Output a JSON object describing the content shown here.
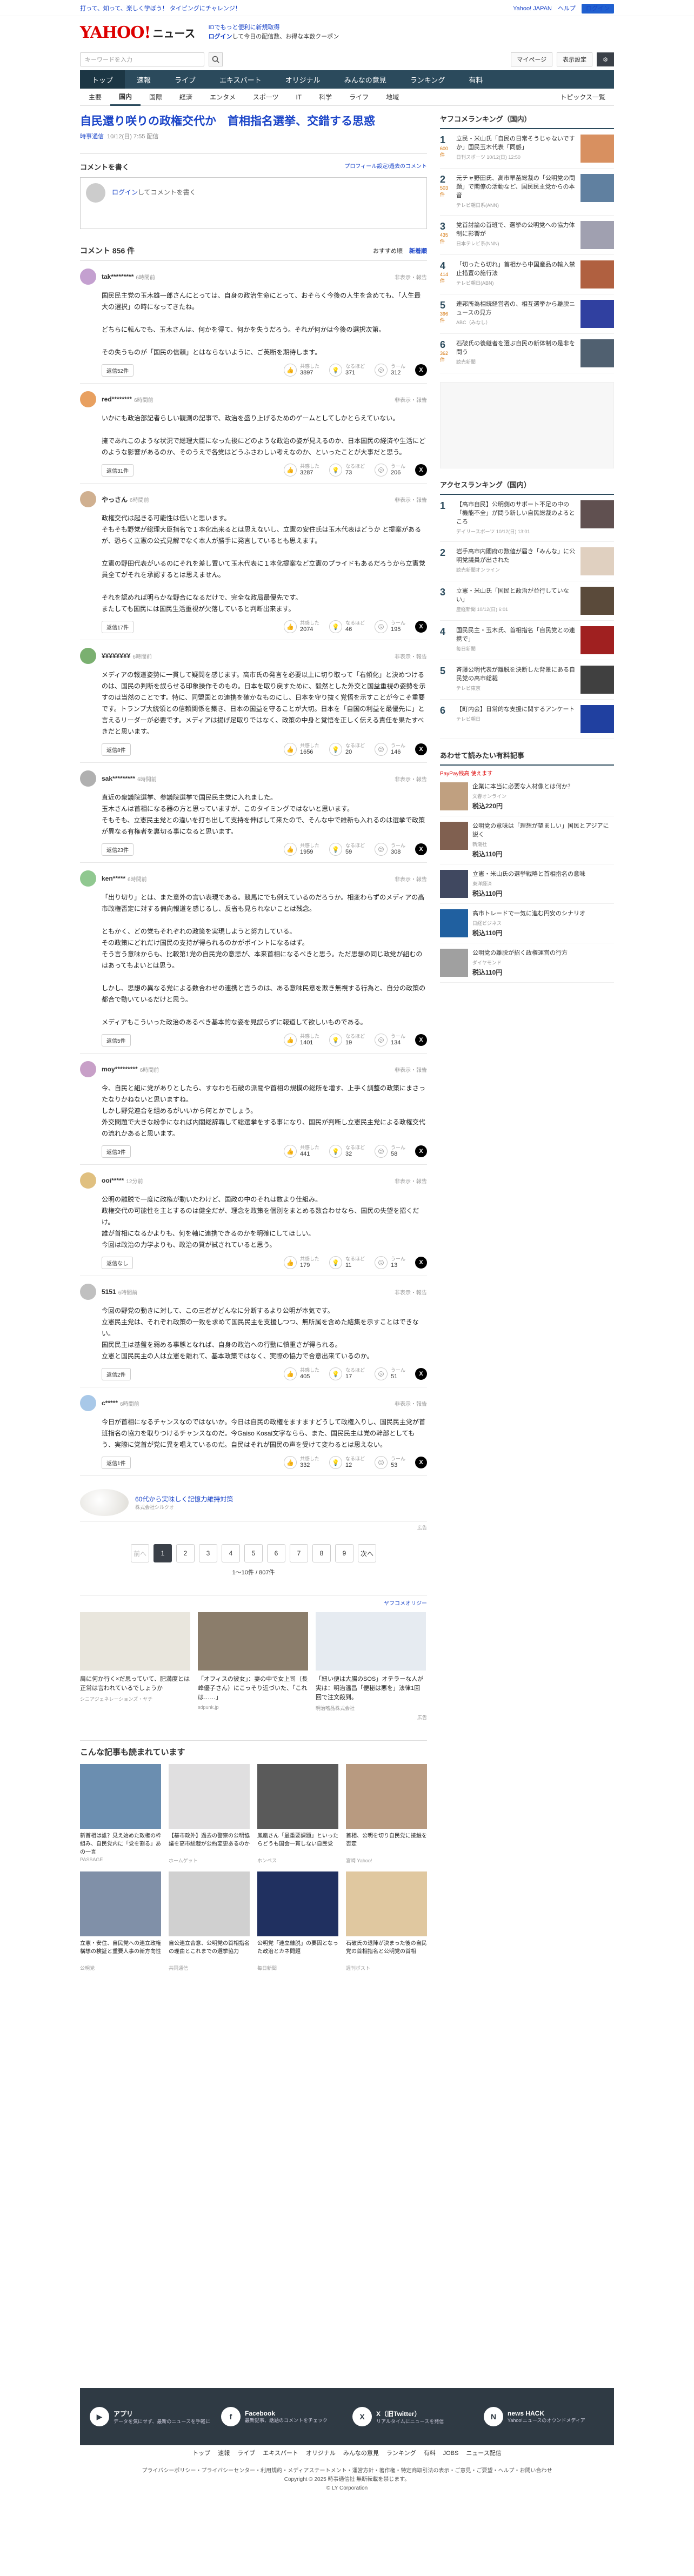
{
  "topbar": {
    "promo": "打って、知って、楽しく学ぼう！ タイピングにチャレンジ！",
    "links": [
      "Yahoo! JAPAN",
      "ヘルプ"
    ],
    "login": "ログイン"
  },
  "header": {
    "logo": "YAHOO!",
    "logo_sub": "ニュース",
    "msg1": "IDでもっと便利に新規取得",
    "msg2_a": "ログイン",
    "msg2_b": "して今日の配信数、お得な本数クーポン"
  },
  "search": {
    "placeholder": "キーワードを入力",
    "mypage": "マイページ",
    "display": "表示設定"
  },
  "nav": [
    "トップ",
    "速報",
    "ライブ",
    "エキスパート",
    "オリジナル",
    "みんなの意見",
    "ランキング",
    "有料"
  ],
  "subnav": [
    "主要",
    "国内",
    "国際",
    "経済",
    "エンタメ",
    "スポーツ",
    "IT",
    "科学",
    "ライフ",
    "地域"
  ],
  "subnav_more": "トピックス一覧",
  "article": {
    "title": "自民還り咲りの政権交代か　首相指名選挙、交錯する思惑",
    "source": "時事通信",
    "date": "10/12(日) 7:55 配信"
  },
  "comment_box": {
    "title": "コメントを書く",
    "link": "プロフィール設定/過去のコメント",
    "login": "ログイン",
    "prompt": "してコメントを書く"
  },
  "comments_header": {
    "count": "コメント 856 件",
    "sort_a": "おすすめ順",
    "sort_b": "新着順"
  },
  "labels": {
    "empathy": "共感した",
    "aha": "なるほど",
    "hmm": "うーん",
    "report": "非表示・報告"
  },
  "comments": [
    {
      "user": "tak*********",
      "time": "6時間前",
      "color": "#c4a0d0",
      "body": "国民民主党の玉木雄一郎さんにとっては、自身の政治生命にとって、おそらく今後の人生を含めても、「人生最大の選択」の時になってきたね。\n\nどちらに転んでも、玉木さんは、何かを得て、何かを失うだろう。それが何かは今後の選択次第。\n\nその失うものが「国民の信頼」とはならないように、ご英断を期待します。",
      "replies": "返信52件",
      "v1": "3897",
      "v2": "371",
      "v3": "312"
    },
    {
      "user": "red********",
      "time": "6時間前",
      "color": "#e8a060",
      "body": "いかにも政治部記者らしい観測の記事で、政治を盛り上げるためのゲームとしてしかとらえていない。\n\n擁であれこのような状況で総理大臣になった後にどのような政治の姿が見えるのか、日本国民の経済や生活にどのような影響があるのか、そのうえで各党はどうふさわしい考えなのか、といったことが大事だと思う。",
      "replies": "返信31件",
      "v1": "3287",
      "v2": "73",
      "v3": "206"
    },
    {
      "user": "やっさん",
      "time": "6時間前",
      "color": "#d0b090",
      "body": "政権交代は起きる可能性は低いと思います。\nそもそも野党が総理大臣指名で１本化出来るとは思えないし、立憲の安住氏は玉木代表はどうか と提案があるが、恐らく立憲の公式見解でなく本人が勝手に発言しているとも思えます。\n\n立憲の野田代表がいるのにそれを差し置いて玉木代表に１本化提案など立憲のプライドもあるだろうから立憲党員全てがそれを承認するとは思えません。\n\nそれを認めれば明らかな野合になるだけで、完全な政局最優先です。\nまたしても国民には国民生活重視が欠落していると判断出来ます。",
      "replies": "返信17件",
      "v1": "2074",
      "v2": "46",
      "v3": "195"
    },
    {
      "user": "¥¥¥¥¥¥¥¥",
      "time": "6時間前",
      "color": "#7ab070",
      "body": "メディアの報道姿勢に一貫して疑問を感じます。高市氏の発言を必要以上に切り取って「右傾化」と決めつけるのは、国民の判断を誤らせる印象操作そのもの。日本を取り戻すために、毅然とした外交と国益重視の姿勢を示すのは当然のことです。特に、同盟国との連携を確かなものにし、日本を守り抜く覚悟を示すことが今こそ重要です。トランプ大統領との信頼関係を築き、日本の国益を守ることが大切。日本を「自国の利益を最優先に」と言えるリーダーが必要です。メディアは揚げ足取りではなく、政策の中身と覚悟を正しく伝える責任を果たすべきだと思います。",
      "replies": "返信8件",
      "v1": "1656",
      "v2": "20",
      "v3": "146"
    },
    {
      "user": "sak*********",
      "time": "6時間前",
      "color": "#b0b0b0",
      "body": "直近の衆議院選挙、参議院選挙で国民民主党に入れました。\n玉木さんは首相になる器の方と思っていますが、このタイミングではないと思います。\nそもそも、立憲民主党との違いを打ち出して支持を伸ばして来たので、そんな中で維新も入れるのは選挙で政策が異なる有権者を裏切る事になると思います。",
      "replies": "返信23件",
      "v1": "1959",
      "v2": "59",
      "v3": "308"
    },
    {
      "user": "ken*****",
      "time": "6時間前",
      "color": "#90c890",
      "body": "「出り切り」とは、また意外の言い表現である。競馬にでも例えているのだろうか。相変わらずのメディアの高市政権否定に対する偏向報道を感じるし、反省も見られないことは残念。\n\nともかく、どの党もそれぞれの政策を実現しようと努力している。\nその政策にどれだけ国民の支持が得られるのかがポイントになるはず。\nそう言う意味からも、比較第1党の自民党の意思が、本来首相になるべきと思う。ただ思想の同じ政党が組むのはあってもよいとは思う。\n\nしかし、思想の異なる党による数合わせの連携と言うのは、ある意味民意を欺き無視する行為と、自分の政策の都合で動いているだけと思う。\n\nメディアもこういった政治のあるべき基本的な姿を見誤らずに報道して欲しいものである。",
      "replies": "返信5件",
      "v1": "1401",
      "v2": "19",
      "v3": "134"
    },
    {
      "user": "moy*********",
      "time": "6時間前",
      "color": "#c8a0c8",
      "body": "今、自民と組に党がありとしたら、すなわち石破の派閥や首相の規模の総所を増す、上手く調整の政策にまさったなりかねないと思いますね。\nしかし野党連合を組めるがいいから何とかでしょう。\n外交問題で大きな紛争になれば内閣総辞職して総選挙をする事になり、国民が判断し立憲民主党による政権交代の流れかあると思います。",
      "replies": "返信3件",
      "v1": "441",
      "v2": "32",
      "v3": "58"
    },
    {
      "user": "ooi*****",
      "time": "12分前",
      "color": "#e0c080",
      "body": "公明の離脱で一度に政権が動いたわけど、国政の中のそれは数より仕組み。\n政権交代の可能性を主とするのは健全だが、理念を政策を個別をまとめる数合わせなら、国民の失望を招くだけ。\n誰が首相になるかよりも、何を軸に連携できるのかを明確にしてほしい。\n今回は政治の力学よりも、政治の質が試されていると思う。",
      "replies": "返信なし",
      "v1": "179",
      "v2": "11",
      "v3": "13"
    },
    {
      "user": "5151",
      "time": "6時間前",
      "color": "#c0c0c0",
      "body": "今回の野党の動きに対して、この三者がどんなに分断するより公明が本気です。\n立憲民主党は、それぞれ政策の一致を求めて国民民主を支援しつつ、無所属を含めた結集を示すことはできない。\n国民民主は基盤を弱める事態となれば、自身の政治への行動に慎重さが得られる。\n立憲と国民民主の人は立憲を離れて、基本政策ではなく、実際の協力で合意出来ているのか。",
      "replies": "返信2件",
      "v1": "405",
      "v2": "17",
      "v3": "51"
    },
    {
      "user": "c*****",
      "time": "6時間前",
      "color": "#a8c8e8",
      "body": "今日が首相になるチャンスなのではないか。今日は自民の政権をますますどうして政権入りし、国民民主党が首班指名の協力を取りつけるチャンスなのだ。今Gaiso Kosai文字ならら、また、国民民主は党の幹部としてもう、実際に党首が党に異を唱えているのだ。自民はそれが国民の声を受けて変わるとは思えない。",
      "replies": "返信1件",
      "v1": "332",
      "v2": "12",
      "v3": "53"
    }
  ],
  "inline_ad": {
    "title": "60代から実味しく記憶力維持対策",
    "sub": "株式会社シルクオ",
    "label": "広告"
  },
  "pager": {
    "prev": "前へ",
    "next": "次へ",
    "pages": [
      "1",
      "2",
      "3",
      "4",
      "5",
      "6",
      "7",
      "8",
      "9"
    ],
    "info": "1〜10件 / 807件"
  },
  "recommend": {
    "head": "ヤフコメオリジー",
    "items": [
      {
        "t": "肩に何か行く×だ思っていて、肥満度とは正常は言われているでしょうか",
        "s": "シニアジェネレーションズ・ヤチ",
        "c": "#e9e6dd"
      },
      {
        "t": "「オフィスの彼女」：妻の中で女上司（長峰優子さん）にこっそり近づいた、「これは……」",
        "s": "sdpunk.jp",
        "c": "#8b7d6b"
      },
      {
        "t": "「紐い便は大腸のSOS」オテラーな人が実は：明治温昌「便秘は悪を」法律1回回で注文殺到。",
        "s": "明治嗜品株式会社",
        "c": "#e6ebf1"
      }
    ]
  },
  "more": {
    "title": "こんな記事も読まれています",
    "items": [
      {
        "t": "新首相は誰？見え始めた政権の枠組み、自民党内に「党を割る」あの一言",
        "s": "PASSAGE",
        "c": "#6b8eb0"
      },
      {
        "t": "【基市政外】過去の警察の公明協議を高市総裁が公約変更あるのか",
        "s": "ホームゲット",
        "c": "#e0dfe0"
      },
      {
        "t": "鳳凰さん「最重要課題」といったらどうも国会一貫しない自民党",
        "s": "ホンペス",
        "c": "#5a5a5a"
      },
      {
        "t": "首相、公明を切り自民党に接触を否定",
        "s": "宮崎 Yahoo!",
        "c": "#b89a80"
      },
      {
        "t": "立憲・安住、自民党への連立政権構想の検証と重要人事の新方向性",
        "s": "公明党",
        "c": "#8090a8"
      },
      {
        "t": "自公連立合意、公明党の首相指名の理由とこれまでの選挙協力",
        "s": "共同通信",
        "c": "#d0d0d0"
      },
      {
        "t": "公明党「連立離脱」の要因となった政治とカネ問題",
        "s": "毎日新聞",
        "c": "#203060"
      },
      {
        "t": "石破氏の退陣が決まった後の自民党の首相指名と公明党の首相",
        "s": "週刊ポスト",
        "c": "#e0c8a0"
      }
    ]
  },
  "side": {
    "rank_title": "ヤフコメランキング（国内）",
    "ranks": [
      {
        "no": "1",
        "cc": "600件",
        "t": "立民・米山氏「自民の日常そうじゃないですか」国民玉木代表「同感」",
        "s": "日刊スポーツ 10/12(日) 12:50",
        "c": "#d89060"
      },
      {
        "no": "2",
        "cc": "503件",
        "t": "元チャ野田氏、高市早苗総裁の「公明党の問題」で閣僚の活動など、国民民主党からの本音",
        "s": "テレビ朝日系(ANN)",
        "c": "#6080a0"
      },
      {
        "no": "3",
        "cc": "435件",
        "t": "党首討論の首班で、選挙の公明党への協力体制に影響が",
        "s": "日本テレビ系(NNN)",
        "c": "#a0a0b0"
      },
      {
        "no": "4",
        "cc": "414件",
        "t": "「切ったら切れ」首相から中国産品の輸入禁止措置の施行法",
        "s": "テレビ朝日(ABN)",
        "c": "#b06040"
      },
      {
        "no": "5",
        "cc": "396件",
        "t": "連邦所為相続経営者の、相互選挙から離脱ニュースの見方",
        "s": "ABC（みなし）",
        "c": "#3040a0"
      },
      {
        "no": "6",
        "cc": "362件",
        "t": "石破氏の後継者を選ぶ自民の新体制の是非を問う",
        "s": "読売新聞",
        "c": "#506070"
      }
    ],
    "access_title": "アクセスランキング（国内）",
    "access": [
      {
        "no": "1",
        "t": "【高市自民】公明側のサポート不足の中の「機能不全」が問う新しい自民総裁のよるところ",
        "s": "デイリースポーツ 10/12(日) 13:01",
        "c": "#605050"
      },
      {
        "no": "2",
        "t": "岩手高市内閣府の数値が届き「みんな」に公明党議員が出された",
        "s": "読売新聞オンライン",
        "c": "#e0d0c0"
      },
      {
        "no": "3",
        "t": "立憲・米山氏「国民と政治が並行していない」",
        "s": "産経新聞 10/12(日) 6:01",
        "c": "#5a4a3a"
      },
      {
        "no": "4",
        "t": "国民民主・玉木氏、首相指名「自民党との連携で」",
        "s": "毎日新聞",
        "c": "#a02020"
      },
      {
        "no": "5",
        "t": "斉藤公明代表が離脱を決断した背景にある自民党の高市総裁",
        "s": "テレビ東京",
        "c": "#404040"
      },
      {
        "no": "6",
        "t": "【町内会】日常的な支援に関するアンケート",
        "s": "テレビ朝日",
        "c": "#2040a0"
      }
    ],
    "paid_title": "あわせて読みたい有料記事",
    "paid_badge": "PayPay残高 使えます",
    "paid": [
      {
        "t": "企業に本当に必要な人材像とは何か？",
        "s": "文春オンライン",
        "p": "税込220円",
        "c": "#c0a080"
      },
      {
        "t": "公明党の意味は「理想が望ましい」国民とアジアに説く",
        "s": "新潮社",
        "p": "税込110円",
        "c": "#806050"
      },
      {
        "t": "立憲・米山氏の選挙戦略と首相指名の意味",
        "s": "東洋経済",
        "p": "税込110円",
        "c": "#404860"
      },
      {
        "t": "高市トレードで一気に進む円安のシナリオ",
        "s": "日経ビジネス",
        "p": "税込110円",
        "c": "#2060a0"
      },
      {
        "t": "公明党の離脱が招く政権運営の行方",
        "s": "ダイヤモンド",
        "p": "税込110円",
        "c": "#a0a0a0"
      }
    ]
  },
  "footer": {
    "items": [
      {
        "ic": "▶",
        "t": "アプリ",
        "s": "データを気にせず、最新のニュースを手軽に"
      },
      {
        "ic": "f",
        "t": "Facebook",
        "s": "最新記事、話題のコメントをチェック"
      },
      {
        "ic": "X",
        "t": "X（旧Twitter）",
        "s": "リアルタイムにニュースを発信"
      },
      {
        "ic": "N",
        "t": "news HACK",
        "s": "Yahoo!ニュースのオウンドメディア"
      }
    ],
    "nav": [
      "トップ",
      "速報",
      "ライブ",
      "エキスパート",
      "オリジナル",
      "みんなの意見",
      "ランキング",
      "有料",
      "JOBS",
      "ニュース配信"
    ],
    "legal1": "プライバシーポリシー・プライバシーセンター・利用規約・メディアステートメント・運営方針・著作権・特定商取引法の表示・ご意見・ご要望・ヘルプ・お問い合わせ",
    "legal2": "Copyright © 2025 時事通信社 無断転載を禁じます。",
    "legal3": "© LY Corporation"
  }
}
